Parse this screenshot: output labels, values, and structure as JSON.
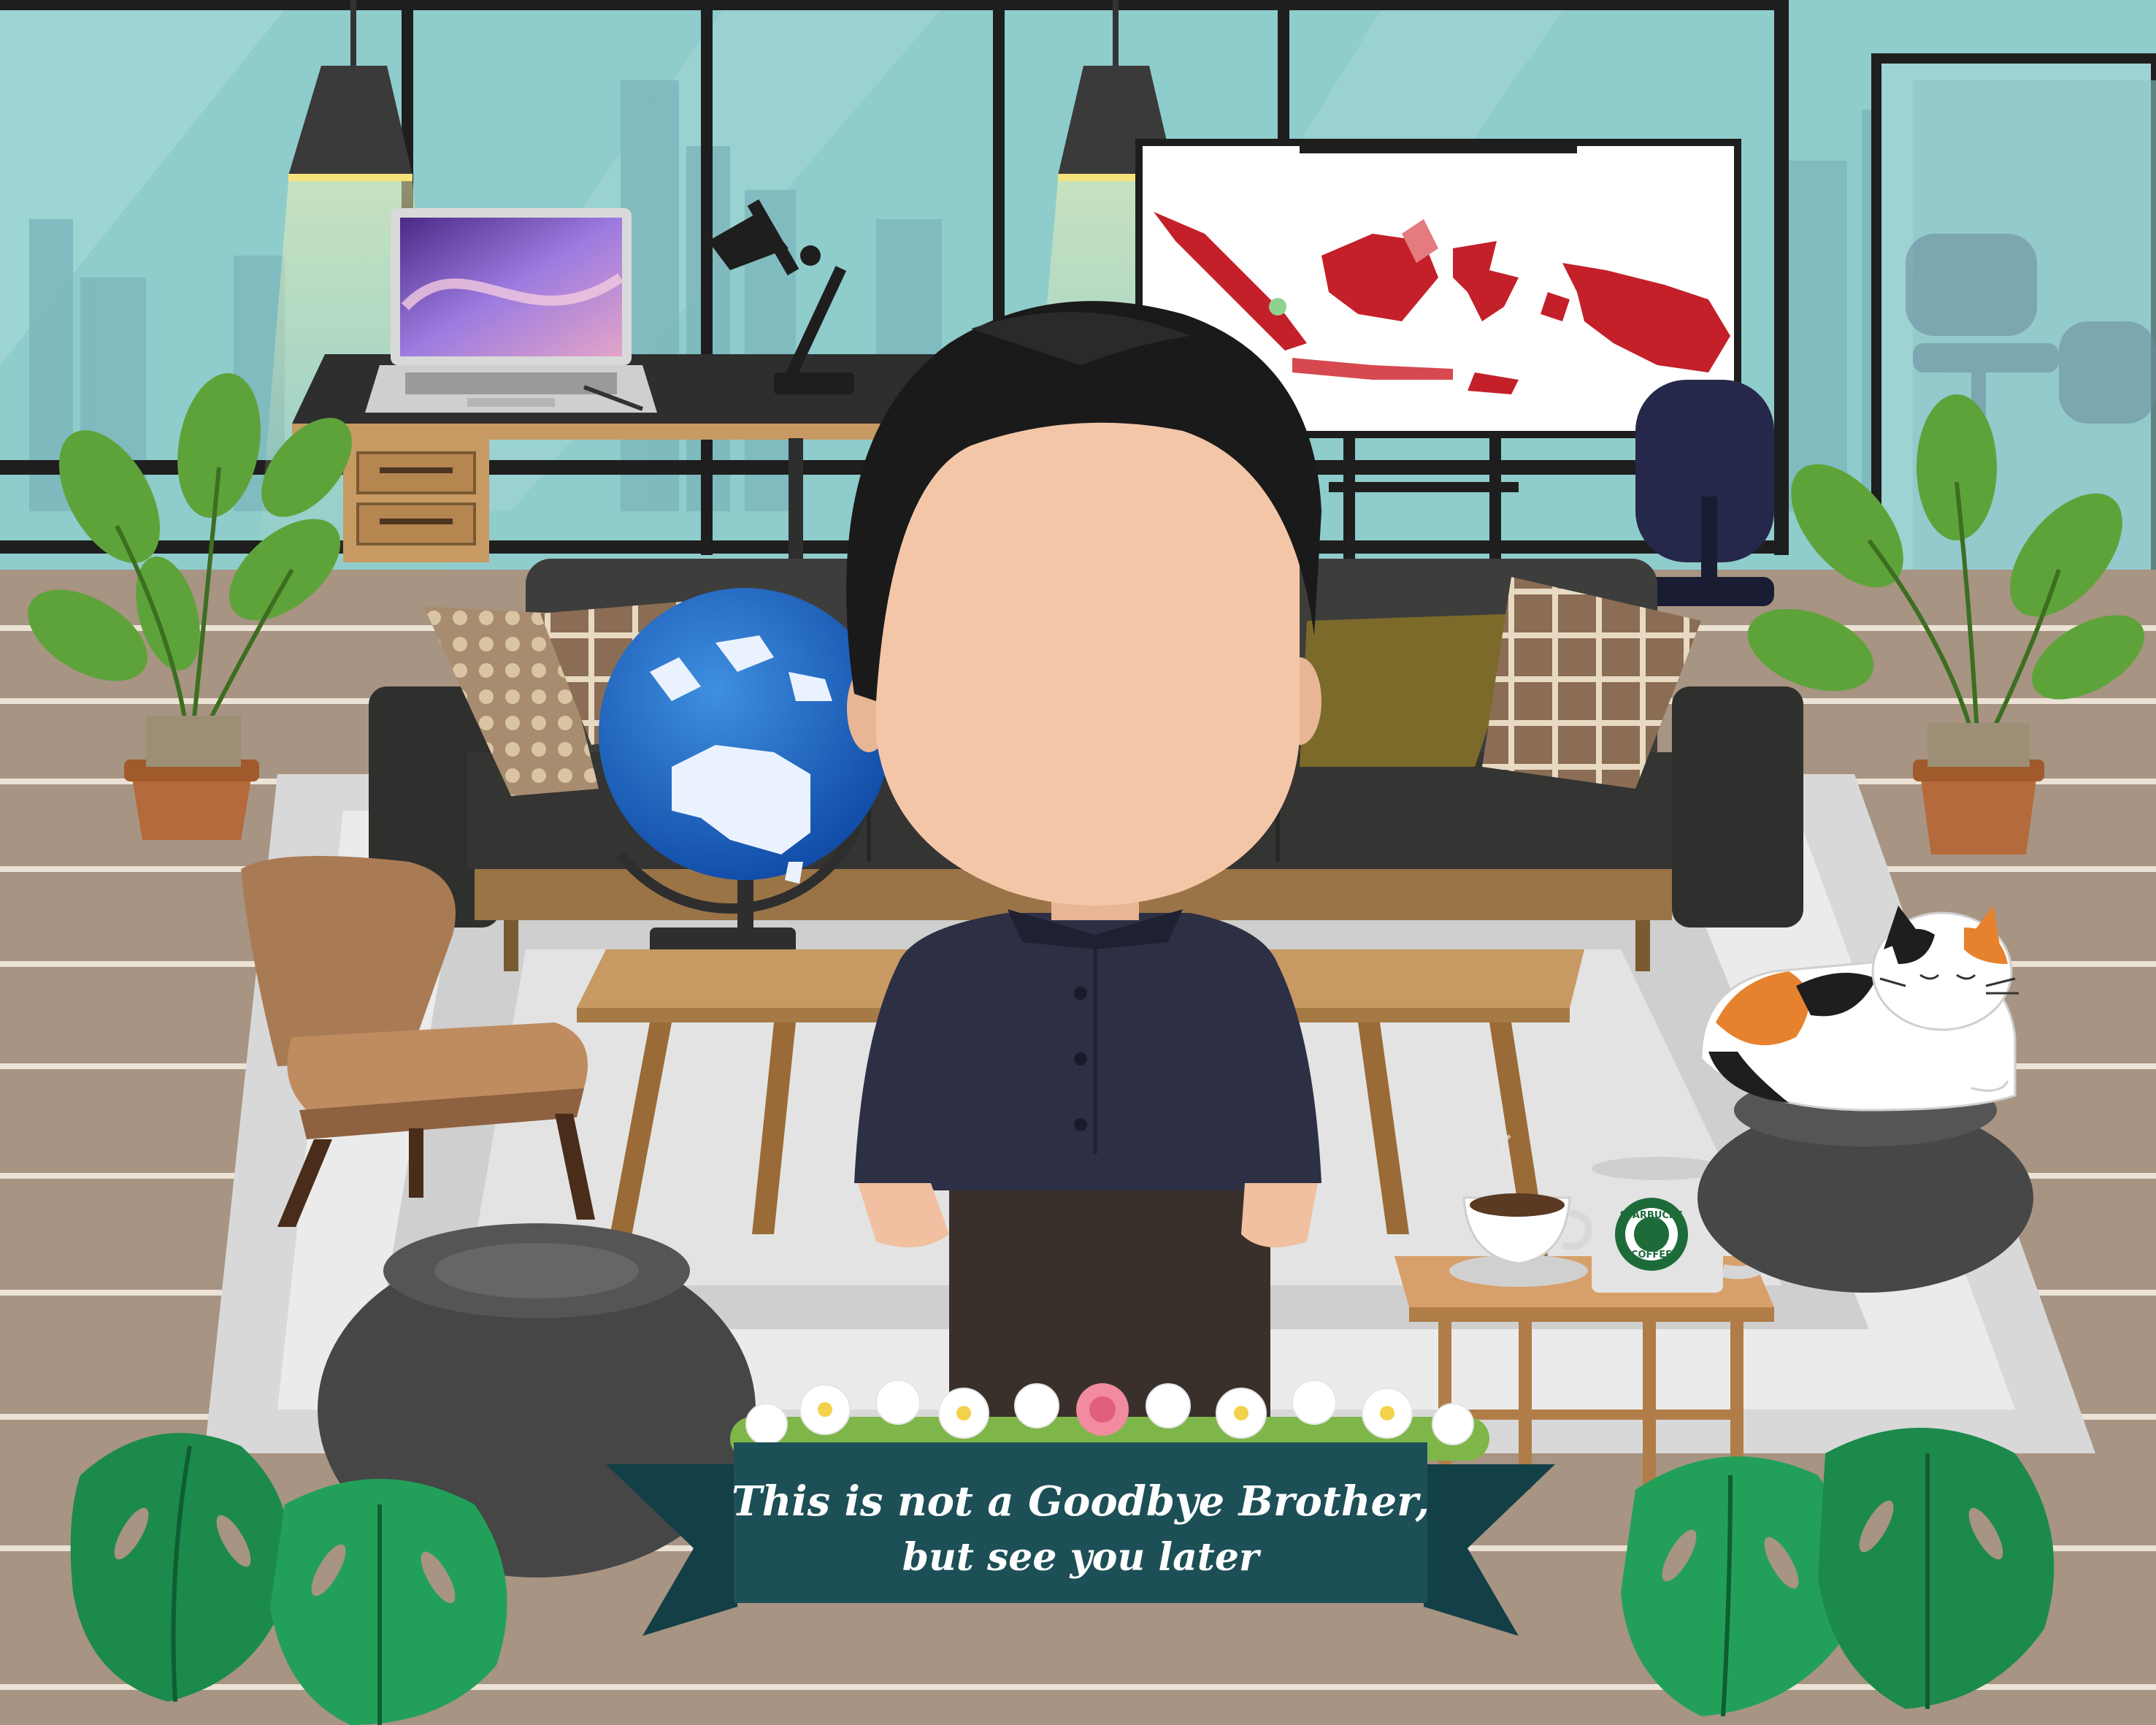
{
  "banner": {
    "line1": "This is not a Goodbye Brother,",
    "line2": "but see you later"
  },
  "mug": {
    "brand_top": "STARBUCKS",
    "brand_bottom": "COFFEE"
  },
  "colors": {
    "window_sky": "#8fcccc",
    "window_frame": "#1e1e1e",
    "floor": "#a79482",
    "banner": "#1d4f57",
    "map_red": "#c42029"
  }
}
